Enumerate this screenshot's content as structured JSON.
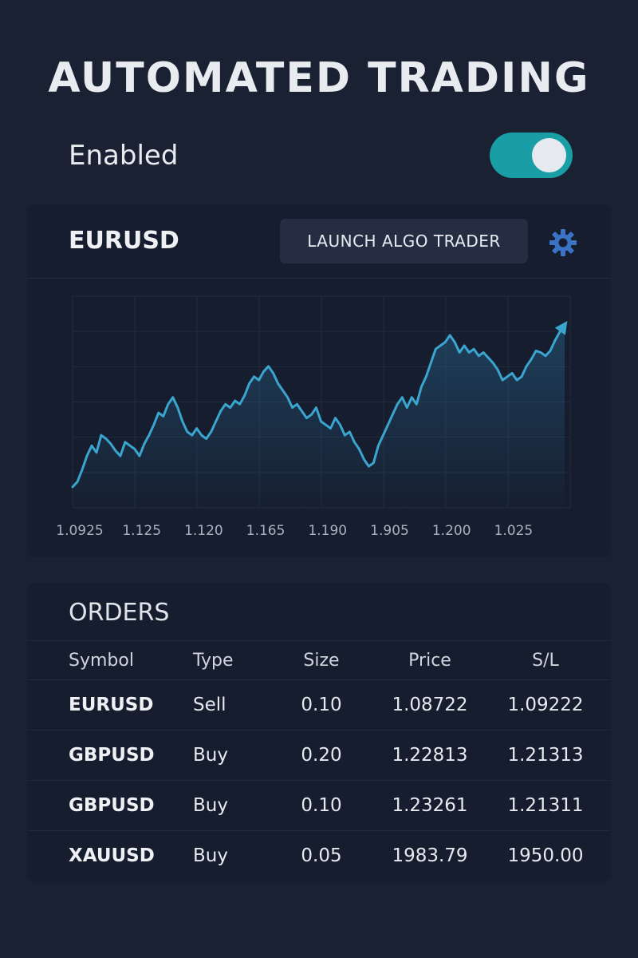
{
  "header": {
    "title": "AUTOMATED TRADING",
    "status_label": "Enabled",
    "toggle_on": true
  },
  "chart_panel": {
    "symbol": "EURUSD",
    "launch_label": "LAUNCH ALGO TRADER",
    "settings_icon": "gear-icon"
  },
  "chart_data": {
    "type": "area",
    "title": "",
    "xlabel": "",
    "ylabel": "",
    "x_tick_labels": [
      "1.0925",
      "1.125",
      "1.120",
      "1.165",
      "1.190",
      "1.905",
      "1.200",
      "1.025"
    ],
    "ylim": [
      0,
      100
    ],
    "grid": true,
    "end_marker": "arrow",
    "values": [
      0,
      3,
      10,
      18,
      24,
      20,
      30,
      28,
      25,
      21,
      18,
      26,
      24,
      22,
      18,
      25,
      30,
      36,
      43,
      41,
      48,
      52,
      46,
      38,
      32,
      30,
      34,
      30,
      28,
      32,
      38,
      44,
      48,
      46,
      50,
      48,
      53,
      60,
      64,
      62,
      67,
      70,
      66,
      60,
      56,
      52,
      46,
      48,
      44,
      40,
      42,
      46,
      38,
      36,
      34,
      40,
      36,
      30,
      32,
      26,
      22,
      16,
      12,
      14,
      24,
      30,
      36,
      42,
      48,
      52,
      46,
      52,
      48,
      58,
      64,
      72,
      80,
      82,
      84,
      88,
      84,
      78,
      82,
      78,
      80,
      76,
      78,
      75,
      72,
      68,
      62,
      64,
      66,
      62,
      64,
      70,
      74,
      79,
      78,
      76,
      79,
      85,
      90,
      94
    ]
  },
  "orders": {
    "title": "ORDERS",
    "columns": [
      "Symbol",
      "Type",
      "Size",
      "Price",
      "S/L"
    ],
    "rows": [
      {
        "symbol": "EURUSD",
        "type": "Sell",
        "size": "0.10",
        "price": "1.08722",
        "sl": "1.09222"
      },
      {
        "symbol": "GBPUSD",
        "type": "Buy",
        "size": "0.20",
        "price": "1.22813",
        "sl": "1.21313"
      },
      {
        "symbol": "GBPUSD",
        "type": "Buy",
        "size": "0.10",
        "price": "1.23261",
        "sl": "1.21311"
      },
      {
        "symbol": "XAUUSD",
        "type": "Buy",
        "size": "0.05",
        "price": "1983.79",
        "sl": "1950.00"
      }
    ]
  },
  "colors": {
    "background": "#1a2133",
    "card": "#161d2e",
    "accent": "#1a9ea6",
    "line": "#3aa5cf",
    "sell": "#ee6b55",
    "buy": "#3fb4d6"
  }
}
